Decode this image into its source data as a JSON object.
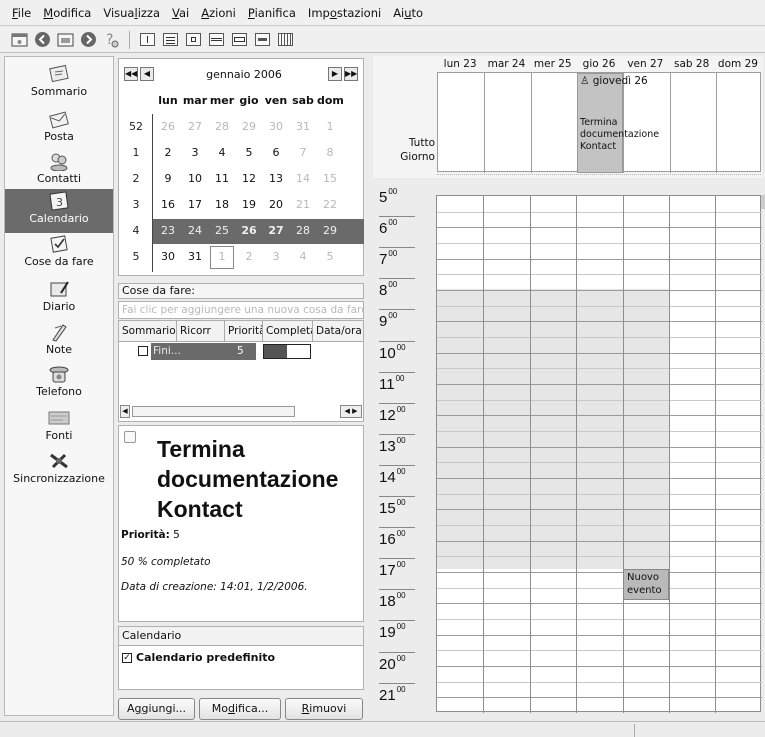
{
  "menubar": {
    "items": [
      {
        "pre": "",
        "key": "F",
        "post": "ile"
      },
      {
        "pre": "",
        "key": "M",
        "post": "odifica"
      },
      {
        "pre": "Visua",
        "key": "l",
        "post": "izza"
      },
      {
        "pre": "",
        "key": "V",
        "post": "ai"
      },
      {
        "pre": "",
        "key": "A",
        "post": "zioni"
      },
      {
        "pre": "",
        "key": "P",
        "post": "ianifica"
      },
      {
        "pre": "Imp",
        "key": "o",
        "post": "stazioni"
      },
      {
        "pre": "Ai",
        "key": "u",
        "post": "to"
      }
    ]
  },
  "sidebar": {
    "items": [
      {
        "label": "Sommario",
        "icon": "summary-icon"
      },
      {
        "label": "Posta",
        "icon": "mail-icon"
      },
      {
        "label": "Contatti",
        "icon": "contacts-icon"
      },
      {
        "label": "Calendario",
        "icon": "calendar-icon",
        "selected": true,
        "icon_text": "3"
      },
      {
        "label": "Cose da fare",
        "icon": "todo-icon"
      },
      {
        "label": "Diario",
        "icon": "journal-icon"
      },
      {
        "label": "Note",
        "icon": "notes-icon"
      },
      {
        "label": "Telefono",
        "icon": "phone-icon"
      },
      {
        "label": "Fonti",
        "icon": "feeds-icon"
      },
      {
        "label": "Sincronizzazione",
        "icon": "sync-icon"
      }
    ]
  },
  "minical": {
    "month": "gennaio 2006",
    "headers": [
      "lun",
      "mar",
      "mer",
      "gio",
      "ven",
      "sab",
      "dom"
    ],
    "weeks": [
      {
        "wk": "52",
        "days": [
          "26",
          "27",
          "28",
          "29",
          "30",
          "31",
          "1"
        ]
      },
      {
        "wk": "1",
        "days": [
          "2",
          "3",
          "4",
          "5",
          "6",
          "7",
          "8"
        ]
      },
      {
        "wk": "2",
        "days": [
          "9",
          "10",
          "11",
          "12",
          "13",
          "14",
          "15"
        ]
      },
      {
        "wk": "3",
        "days": [
          "16",
          "17",
          "18",
          "19",
          "20",
          "21",
          "22"
        ]
      },
      {
        "wk": "4",
        "days": [
          "23",
          "24",
          "25",
          "26",
          "27",
          "28",
          "29"
        ]
      },
      {
        "wk": "5",
        "days": [
          "30",
          "31",
          "1",
          "2",
          "3",
          "4",
          "5"
        ]
      }
    ]
  },
  "todo": {
    "label": "Cose da fare:",
    "quick_add_placeholder": "Fai clic per aggiungere una nuova cosa da fare",
    "columns": [
      "Sommario",
      "Ricorr",
      "Priorità",
      "Completa",
      "Data/ora sc"
    ],
    "row": {
      "summary": "Fini...",
      "priority": "5"
    }
  },
  "detail": {
    "title": "Termina documentazione Kontact",
    "priority_label": "Priorità:",
    "priority_value": "5",
    "completed": "50 % completato",
    "created": "Data di creazione: 14:01, 1/2/2006."
  },
  "calendars": {
    "title": "Calendario",
    "item": "Calendario predefinito",
    "buttons": {
      "add": {
        "pre": "A",
        "key": "g",
        "post": "giungi..."
      },
      "edit": {
        "pre": "Mo",
        "key": "d",
        "post": "ifica..."
      },
      "remove": {
        "pre": "",
        "key": "R",
        "post": "imuovi"
      }
    }
  },
  "agenda": {
    "days": [
      "lun 23",
      "mar 24",
      "mer 25",
      "gio 26",
      "ven 27",
      "sab 28",
      "dom 29"
    ],
    "allday_label": "Tutto Giorno",
    "allday_event_title": "giovedì 26",
    "allday_event_text": "Termina documentazione Kontact",
    "hours": [
      "5",
      "6",
      "7",
      "8",
      "9",
      "10",
      "11",
      "12",
      "13",
      "14",
      "15",
      "16",
      "17",
      "18",
      "19",
      "20",
      "21"
    ],
    "minutes": "00",
    "new_event": "Nuovo evento"
  }
}
